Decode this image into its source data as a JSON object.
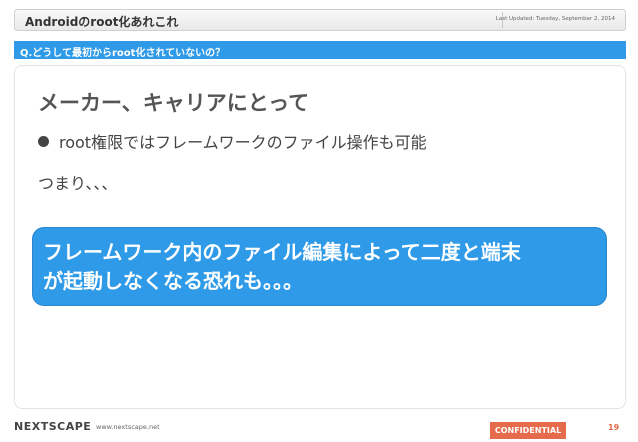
{
  "header": {
    "title": "Androidのroot化あれこれ",
    "date": "Last Updated: Tuesday, September 2, 2014"
  },
  "question": "Q.どうして最初からroot化されていないの？",
  "content": {
    "heading": "メーカー、キャリアにとって",
    "bullet": "root権限ではフレームワークのファイル操作も可能",
    "subtext": "つまり、、、",
    "callout_line1": "フレームワーク内のファイル編集によって二度と端末",
    "callout_line2": "が起動しなくなる恐れも。。。"
  },
  "footer": {
    "logo": "NEXTSCAPE",
    "url": "www.nextscape.net",
    "confidential": "CONFIDENTIAL",
    "page": "19"
  },
  "colors": {
    "accent_blue": "#2e9ae8",
    "confidential_orange": "#e66b4c"
  }
}
